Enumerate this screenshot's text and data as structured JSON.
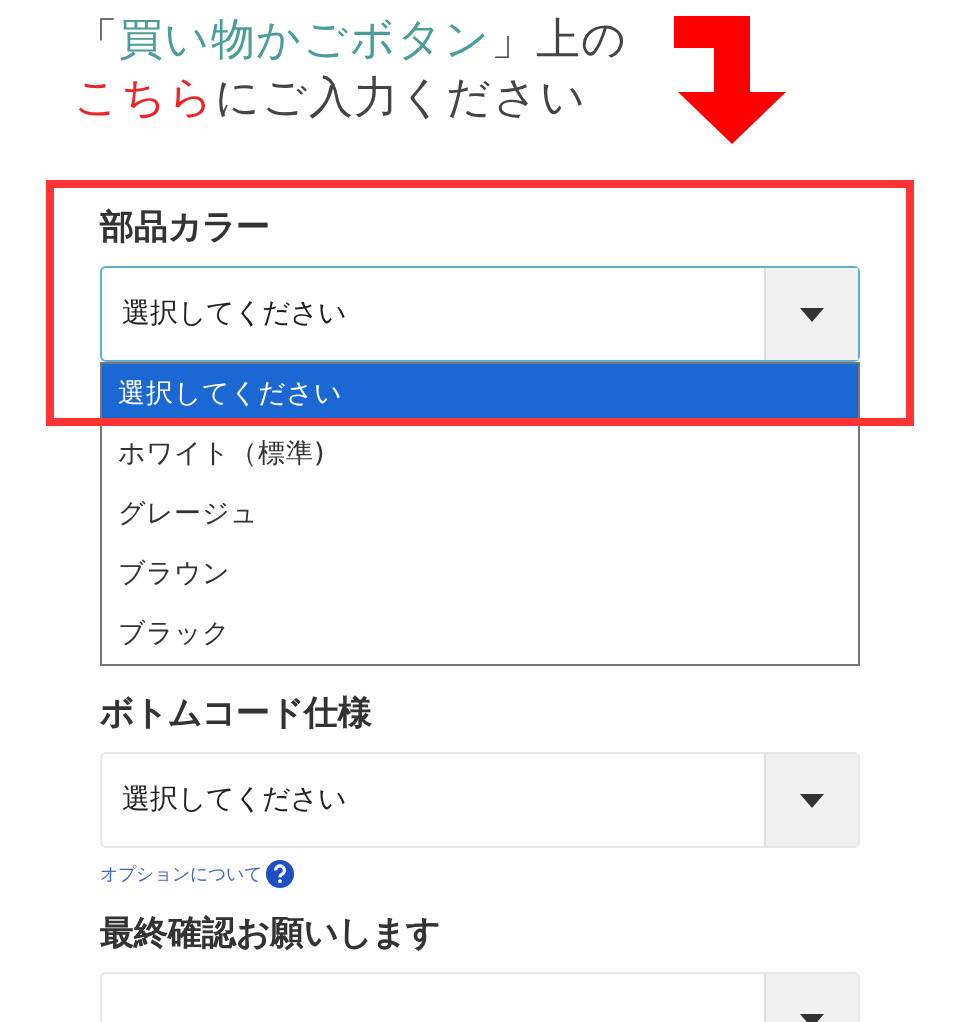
{
  "heading": {
    "lines": [
      [
        {
          "text": "「"
        },
        {
          "text": "買い物かごボタン",
          "color": "#4a9e9a"
        },
        {
          "text": "」上の"
        }
      ],
      [
        {
          "text": "こちら",
          "color": "#ee2222"
        },
        {
          "text": "にご入力ください"
        }
      ]
    ]
  },
  "fields": [
    {
      "label": "部品カラー",
      "value": "選択してください",
      "open": true,
      "highlighted": true,
      "options": [
        {
          "text": "選択してください",
          "selected": true
        },
        {
          "text": "ホワイト（標準)",
          "selected": false
        },
        {
          "text": "グレージュ",
          "selected": false
        },
        {
          "text": "ブラウン",
          "selected": false
        },
        {
          "text": "ブラック",
          "selected": false
        }
      ]
    },
    {
      "label": "ボトムコード仕様",
      "value": "選択してください",
      "open": false,
      "help_link": "オプションについて"
    },
    {
      "label": "最終確認お願いします",
      "open": false
    }
  ]
}
